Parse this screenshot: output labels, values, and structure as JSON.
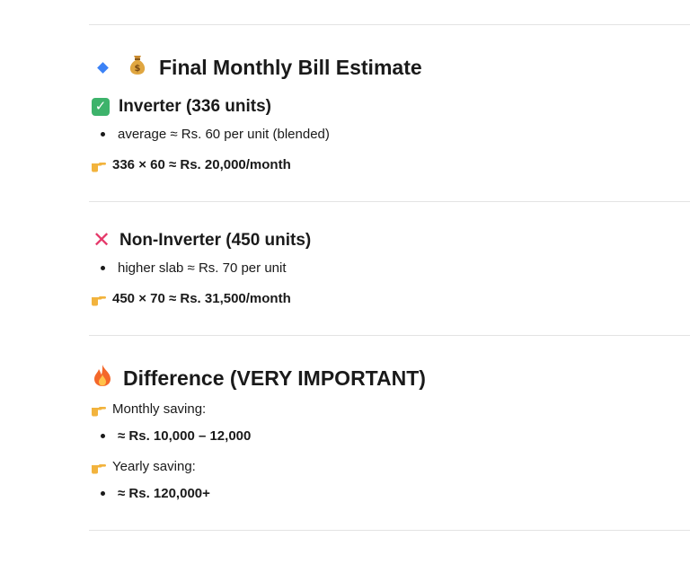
{
  "section_main": {
    "title": "Final Monthly Bill Estimate",
    "icons": {
      "bullet": "diamond-icon",
      "money": "money-bag-icon"
    }
  },
  "inverter": {
    "heading": "Inverter (336 units)",
    "bullet": "average ≈ Rs. 60 per unit (blended)",
    "calc": "336 × 60 ≈ Rs. 20,000/month",
    "icon": "check-icon"
  },
  "non_inverter": {
    "heading": "Non-Inverter (450 units)",
    "bullet": "higher slab ≈ Rs. 70 per unit",
    "calc": "450 × 70 ≈ Rs. 31,500/month",
    "icon": "cross-icon"
  },
  "difference": {
    "title": "Difference (VERY IMPORTANT)",
    "monthly_label": "Monthly saving:",
    "monthly_value": "≈ Rs. 10,000 – 12,000",
    "yearly_label": "Yearly saving:",
    "yearly_value": "≈ Rs. 120,000+",
    "icon": "fire-icon"
  },
  "colors": {
    "accent_blue": "#3b82f6",
    "check_green": "#3db36b",
    "cross_red": "#e5396a",
    "divider": "#e3e3e3"
  }
}
